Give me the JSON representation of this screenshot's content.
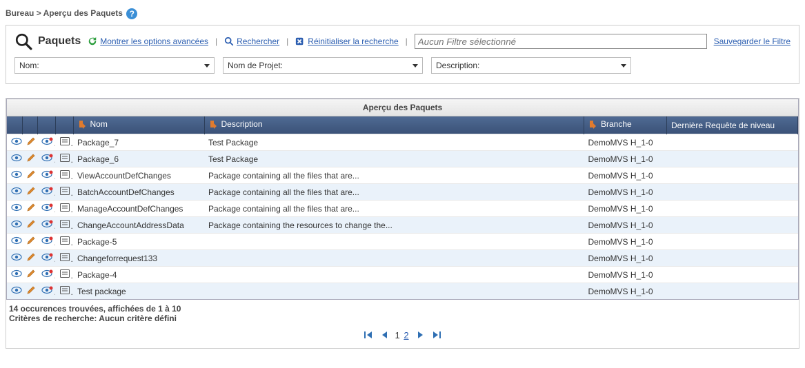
{
  "breadcrumb": {
    "root": "Bureau",
    "sep": ">",
    "current": "Aperçu des Paquets"
  },
  "search": {
    "title": "Paquets",
    "advanced": "Montrer les options avancées",
    "do_search": "Rechercher",
    "reset": "Réinitialiser la recherche",
    "filter_placeholder": "Aucun Filtre sélectionné",
    "save_filter": "Sauvegarder le Filtre"
  },
  "filters": {
    "name": "Nom:",
    "project": "Nom de Projet:",
    "description": "Description:"
  },
  "grid": {
    "title": "Aperçu des Paquets",
    "columns": {
      "name": "Nom",
      "description": "Description",
      "branch": "Branche",
      "last_request": "Dernière Requête de niveau"
    },
    "rows": [
      {
        "name": "Package_7",
        "description": "Test Package",
        "branch": "DemoMVS H_1-0",
        "last": ""
      },
      {
        "name": "Package_6",
        "description": "Test Package",
        "branch": "DemoMVS H_1-0",
        "last": ""
      },
      {
        "name": "ViewAccountDefChanges",
        "description": "Package containing all the files that are...",
        "branch": "DemoMVS H_1-0",
        "last": ""
      },
      {
        "name": "BatchAccountDefChanges",
        "description": "Package containing all the files that are...",
        "branch": "DemoMVS H_1-0",
        "last": ""
      },
      {
        "name": "ManageAccountDefChanges",
        "description": "Package containing all the files that are...",
        "branch": "DemoMVS H_1-0",
        "last": ""
      },
      {
        "name": "ChangeAccountAddressData",
        "description": "Package containing the resources to change the...",
        "branch": "DemoMVS H_1-0",
        "last": ""
      },
      {
        "name": "Package-5",
        "description": "",
        "branch": "DemoMVS H_1-0",
        "last": ""
      },
      {
        "name": "Changeforrequest133",
        "description": "",
        "branch": "DemoMVS H_1-0",
        "last": ""
      },
      {
        "name": "Package-4",
        "description": "",
        "branch": "DemoMVS H_1-0",
        "last": ""
      },
      {
        "name": "Test package",
        "description": "",
        "branch": "DemoMVS H_1-0",
        "last": ""
      }
    ]
  },
  "footer": {
    "count_line": "14 occurences trouvées, affichées de 1 à 10",
    "criteria_line": "Critères de recherche: Aucun critère défini"
  },
  "pager": {
    "current": "1",
    "next_page": "2"
  }
}
